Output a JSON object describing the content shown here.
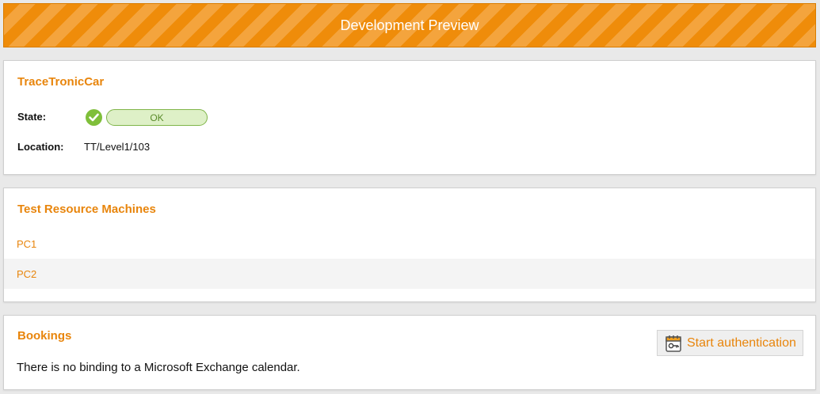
{
  "banner": {
    "title": "Development Preview"
  },
  "device": {
    "name": "TraceTronicCar",
    "state_label": "State:",
    "state_value": "OK",
    "location_label": "Location:",
    "location_value": "TT/Level1/103"
  },
  "machines": {
    "title": "Test Resource Machines",
    "items": [
      {
        "label": "PC1"
      },
      {
        "label": "PC2"
      }
    ]
  },
  "bookings": {
    "title": "Bookings",
    "message": "There is no binding to a Microsoft Exchange calendar.",
    "auth_button_label": "Start authentication",
    "auth_icon": "calendar-key-icon"
  },
  "colors": {
    "accent": "#e8850c",
    "banner": "#ef8c0a",
    "ok_green": "#7fbf3a",
    "ok_badge_bg": "#def0c7"
  }
}
